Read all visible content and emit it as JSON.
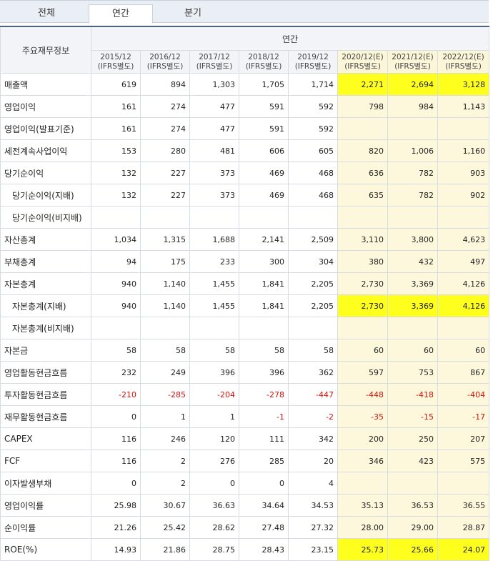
{
  "tabs": [
    {
      "label": "전체",
      "active": false
    },
    {
      "label": "연간",
      "active": true
    },
    {
      "label": "분기",
      "active": false
    }
  ],
  "table": {
    "row_header_title": "주요재무정보",
    "period_group_label": "연간",
    "columns": [
      {
        "year": "2015/12",
        "basis": "(IFRS별도)",
        "estimate": false
      },
      {
        "year": "2016/12",
        "basis": "(IFRS별도)",
        "estimate": false
      },
      {
        "year": "2017/12",
        "basis": "(IFRS별도)",
        "estimate": false
      },
      {
        "year": "2018/12",
        "basis": "(IFRS별도)",
        "estimate": false
      },
      {
        "year": "2019/12",
        "basis": "(IFRS별도)",
        "estimate": false
      },
      {
        "year": "2020/12(E)",
        "basis": "(IFRS별도)",
        "estimate": true
      },
      {
        "year": "2021/12(E)",
        "basis": "(IFRS별도)",
        "estimate": true
      },
      {
        "year": "2022/12(E)",
        "basis": "(IFRS별도)",
        "estimate": true
      }
    ],
    "rows": [
      {
        "label": "매출액",
        "indent": false,
        "highlight_estimates": true,
        "values": [
          "619",
          "894",
          "1,303",
          "1,705",
          "1,714",
          "2,271",
          "2,694",
          "3,128"
        ]
      },
      {
        "label": "영업이익",
        "indent": false,
        "highlight_estimates": false,
        "values": [
          "161",
          "274",
          "477",
          "591",
          "592",
          "798",
          "984",
          "1,143"
        ]
      },
      {
        "label": "영업이익(발표기준)",
        "indent": false,
        "highlight_estimates": false,
        "values": [
          "161",
          "274",
          "477",
          "591",
          "592",
          "",
          "",
          ""
        ]
      },
      {
        "label": "세전계속사업이익",
        "indent": false,
        "highlight_estimates": false,
        "values": [
          "153",
          "280",
          "481",
          "606",
          "605",
          "820",
          "1,006",
          "1,160"
        ]
      },
      {
        "label": "당기순이익",
        "indent": false,
        "highlight_estimates": false,
        "values": [
          "132",
          "227",
          "373",
          "469",
          "468",
          "636",
          "782",
          "903"
        ]
      },
      {
        "label": "당기순이익(지배)",
        "indent": true,
        "highlight_estimates": false,
        "values": [
          "132",
          "227",
          "373",
          "469",
          "468",
          "635",
          "782",
          "902"
        ]
      },
      {
        "label": "당기순이익(비지배)",
        "indent": true,
        "highlight_estimates": false,
        "values": [
          "",
          "",
          "",
          "",
          "",
          "",
          "",
          ""
        ]
      },
      {
        "label": "자산총계",
        "indent": false,
        "highlight_estimates": false,
        "values": [
          "1,034",
          "1,315",
          "1,688",
          "2,141",
          "2,509",
          "3,110",
          "3,800",
          "4,623"
        ]
      },
      {
        "label": "부채총계",
        "indent": false,
        "highlight_estimates": false,
        "values": [
          "94",
          "175",
          "233",
          "300",
          "304",
          "380",
          "432",
          "497"
        ]
      },
      {
        "label": "자본총계",
        "indent": false,
        "highlight_estimates": false,
        "values": [
          "940",
          "1,140",
          "1,455",
          "1,841",
          "2,205",
          "2,730",
          "3,369",
          "4,126"
        ]
      },
      {
        "label": "자본총계(지배)",
        "indent": true,
        "highlight_estimates": true,
        "values": [
          "940",
          "1,140",
          "1,455",
          "1,841",
          "2,205",
          "2,730",
          "3,369",
          "4,126"
        ]
      },
      {
        "label": "자본총계(비지배)",
        "indent": true,
        "highlight_estimates": false,
        "values": [
          "",
          "",
          "",
          "",
          "",
          "",
          "",
          ""
        ]
      },
      {
        "label": "자본금",
        "indent": false,
        "highlight_estimates": false,
        "values": [
          "58",
          "58",
          "58",
          "58",
          "58",
          "60",
          "60",
          "60"
        ]
      },
      {
        "label": "영업활동현금흐름",
        "indent": false,
        "highlight_estimates": false,
        "values": [
          "232",
          "249",
          "396",
          "396",
          "362",
          "597",
          "753",
          "867"
        ]
      },
      {
        "label": "투자활동현금흐름",
        "indent": false,
        "highlight_estimates": false,
        "values": [
          "-210",
          "-285",
          "-204",
          "-278",
          "-447",
          "-448",
          "-418",
          "-404"
        ]
      },
      {
        "label": "재무활동현금흐름",
        "indent": false,
        "highlight_estimates": false,
        "values": [
          "0",
          "1",
          "1",
          "-1",
          "-2",
          "-35",
          "-15",
          "-17"
        ]
      },
      {
        "label": "CAPEX",
        "indent": false,
        "highlight_estimates": false,
        "values": [
          "116",
          "246",
          "120",
          "111",
          "342",
          "200",
          "250",
          "207"
        ]
      },
      {
        "label": "FCF",
        "indent": false,
        "highlight_estimates": false,
        "values": [
          "116",
          "2",
          "276",
          "285",
          "20",
          "346",
          "423",
          "575"
        ]
      },
      {
        "label": "이자발생부채",
        "indent": false,
        "highlight_estimates": false,
        "values": [
          "0",
          "2",
          "0",
          "0",
          "4",
          "",
          "",
          ""
        ]
      },
      {
        "label": "영업이익률",
        "indent": false,
        "highlight_estimates": false,
        "values": [
          "25.98",
          "30.67",
          "36.63",
          "34.64",
          "34.53",
          "35.13",
          "36.53",
          "36.55"
        ]
      },
      {
        "label": "순이익률",
        "indent": false,
        "highlight_estimates": false,
        "values": [
          "21.26",
          "25.42",
          "28.62",
          "27.48",
          "27.32",
          "28.00",
          "29.00",
          "28.87"
        ]
      },
      {
        "label": "ROE(%)",
        "indent": false,
        "highlight_estimates": true,
        "values": [
          "14.93",
          "21.86",
          "28.75",
          "28.43",
          "23.15",
          "25.73",
          "25.66",
          "24.07"
        ]
      }
    ]
  },
  "colors": {
    "negative": "#d3130e",
    "estimate_background": "#fdf8dc",
    "highlight": "#ffff1e",
    "header_background": "#f2f4f7",
    "tab_bar_background": "#eaeef5"
  }
}
